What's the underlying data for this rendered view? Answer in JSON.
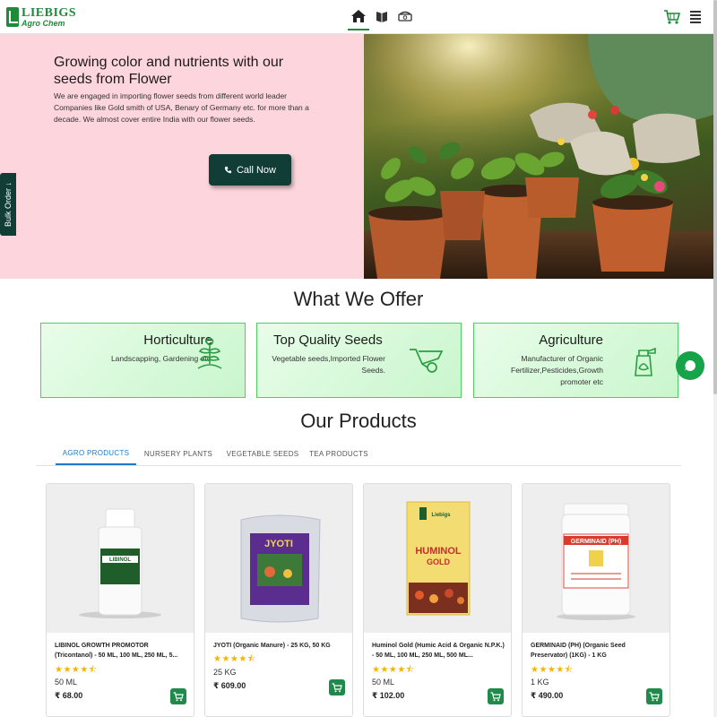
{
  "header": {
    "logo_brand": "LIEBIGS",
    "logo_sub": "Agro Chem",
    "nav": [
      {
        "icon": "home-icon"
      },
      {
        "icon": "book-icon"
      },
      {
        "icon": "phone-icon"
      }
    ]
  },
  "hero": {
    "title": "Growing color and nutrients with our seeds from Flower",
    "description": "We are engaged in importing flower seeds from different world leader Companies like Gold smith of USA, Benary of Germany etc. for more than a decade. We almost cover entire India with our flower seeds.",
    "call_button": "Call Now"
  },
  "bulk_order": "Bulk Order ↓",
  "offers": {
    "title": "What We Offer",
    "items": [
      {
        "title": "Horticulture",
        "text": "Landscapping, Gardening etc",
        "icon": "sprout-icon"
      },
      {
        "title": "Top Quality Seeds",
        "text": "Vegetable seeds,Imported Flower Seeds.",
        "icon": "wheelbarrow-icon"
      },
      {
        "title": "Agriculture",
        "text": "Manufacturer of Organic Fertilizer,Pesticides,Growth promoter etc",
        "icon": "spray-bottle-icon"
      }
    ]
  },
  "products": {
    "title": "Our Products",
    "tabs": [
      "AGRO PRODUCTS",
      "NURSERY PLANTS",
      "VEGETABLE SEEDS",
      "TEA PRODUCTS"
    ],
    "active_tab": 0,
    "items": [
      {
        "name": "LIBINOL GROWTH PROMOTOR (Tricontanol) - 50 ML, 100 ML, 250 ML, 5...",
        "rating": 4.5,
        "size": "50 ML",
        "price": "₹ 68.00"
      },
      {
        "name": "JYOTI (Organic Manure) - 25 KG, 50 KG",
        "rating": 4.5,
        "size": "25 KG",
        "price": "₹ 609.00"
      },
      {
        "name": "Huminol Gold (Humic Acid & Organic N.P.K.) - 50 ML, 100 ML, 250 ML, 500 ML...",
        "rating": 4.5,
        "size": "50 ML",
        "price": "₹ 102.00"
      },
      {
        "name": "GERMINAID (PH) (Organic Seed Preservator) (1KG) - 1 KG",
        "rating": 4.5,
        "size": "1 KG",
        "price": "₹ 490.00"
      }
    ],
    "stars_display": "★★★★⯪"
  },
  "colors": {
    "brand_green": "#1f8a3a",
    "hero_pink": "#fdd5dc",
    "button_dark": "#123d36",
    "tab_blue": "#1e7ac8",
    "star_gold": "#f2b600"
  }
}
